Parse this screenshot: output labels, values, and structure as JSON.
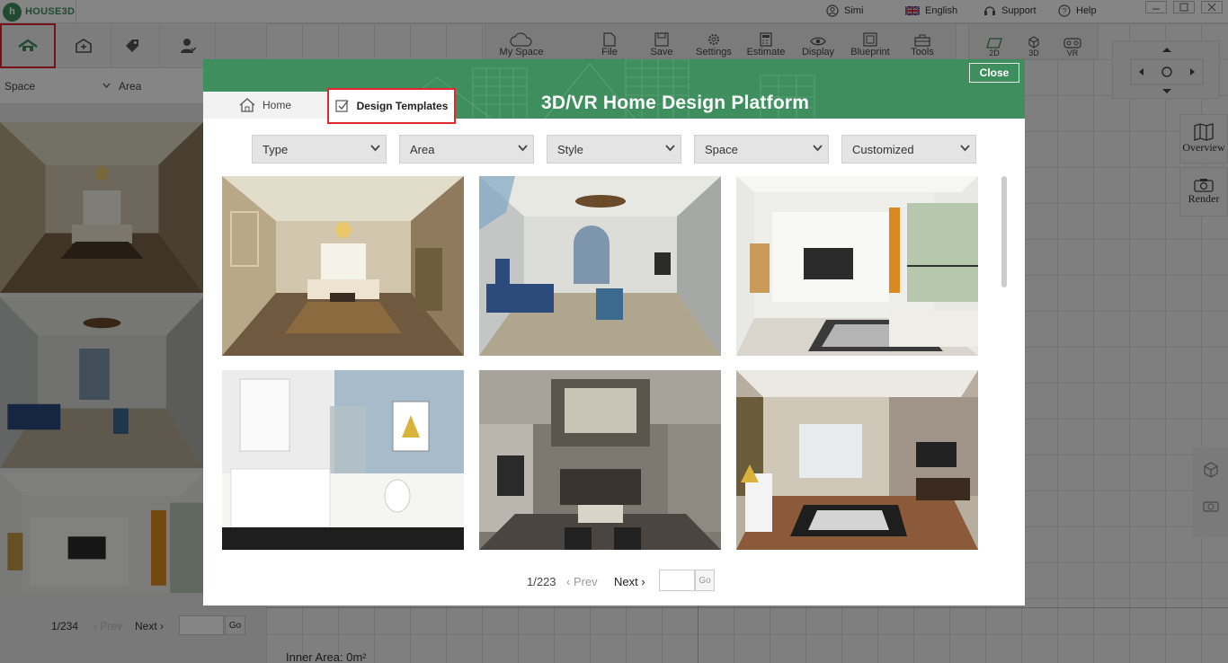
{
  "app": {
    "logo_letter": "h",
    "logo_text": "HOUSE3D"
  },
  "topnav": {
    "user": "Simi",
    "language": "English",
    "support": "Support",
    "help": "Help"
  },
  "left_panel": {
    "filters": {
      "space": "Space",
      "area": "Area"
    },
    "pager": {
      "page": "1/234",
      "prev": "Prev",
      "next": "Next",
      "go": "Go"
    }
  },
  "toolbar": {
    "my_space": "My Space",
    "file": "File",
    "save": "Save",
    "settings": "Settings",
    "estimate": "Estimate",
    "display": "Display",
    "blueprint": "Blueprint",
    "tools": "Tools"
  },
  "view_modes": {
    "2d": "2D",
    "3d": "3D",
    "vr": "VR"
  },
  "side_buttons": {
    "overview": "Overview",
    "render": "Render"
  },
  "canvas": {
    "inner_area": "Inner Area: 0m²"
  },
  "modal": {
    "title": "3D/VR Home Design Platform",
    "close": "Close",
    "tabs": {
      "home": "Home",
      "design_templates": "Design Templates"
    },
    "filters": [
      "Type",
      "Area",
      "Style",
      "Space",
      "Customized"
    ],
    "pager": {
      "page": "1/223",
      "prev": "Prev",
      "next": "Next",
      "go": "Go"
    }
  },
  "colors": {
    "brand_green": "#3f8f5e",
    "highlight_red": "#e0282e"
  }
}
